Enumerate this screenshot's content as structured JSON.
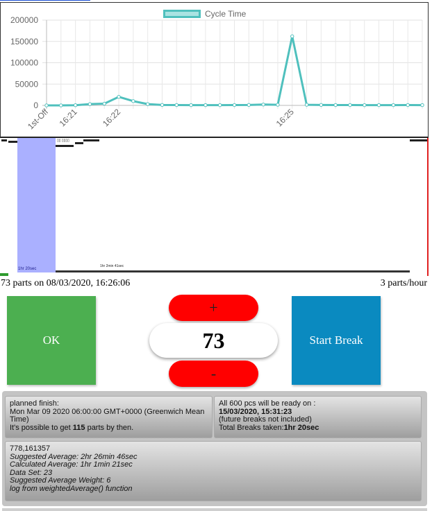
{
  "chart_data": {
    "type": "line",
    "legend": "Cycle Time",
    "x": [
      "1st-Off",
      "",
      "16:21",
      "",
      "",
      "16:22",
      "",
      "",
      "",
      "",
      "",
      "",
      "",
      "",
      "",
      "",
      "",
      "16:25",
      "",
      "",
      "",
      "",
      "",
      "",
      "",
      "",
      ""
    ],
    "values": [
      0,
      0,
      500,
      3000,
      4000,
      20000,
      10000,
      3000,
      1000,
      800,
      700,
      700,
      600,
      800,
      1000,
      2000,
      1500,
      162000,
      1500,
      1000,
      800,
      800,
      600,
      700,
      700,
      800,
      700
    ],
    "ylim": [
      0,
      200000
    ],
    "yticks": [
      "200000",
      "150000",
      "100000",
      "50000",
      "0"
    ],
    "color": "#4fc0bd",
    "grid": true,
    "legend_position": "top"
  },
  "timeline": {
    "break_label": "1hr 20sec",
    "tiny_label": "1hr 2min 41sec"
  },
  "status": {
    "parts_info": "73 parts on 08/03/2020, 16:26:06",
    "rate": "3 parts/hour"
  },
  "buttons": {
    "ok": "OK",
    "start_break": "Start Break",
    "plus": "+",
    "minus": "-"
  },
  "counter": {
    "value": "73"
  },
  "plan": {
    "label": "planned finish:",
    "date": "Mon Mar 09 2020 06:00:00 GMT+0000 (Greenwich Mean Time)",
    "possible_prefix": "It's possible to get ",
    "possible_count": "115",
    "possible_suffix": " parts by then."
  },
  "ready": {
    "label": "All 600 pcs will be ready on :",
    "date": "15/03/2020, 15:31:23",
    "note": "(future breaks not included)",
    "breaks_prefix": "Total Breaks taken:",
    "breaks_value": "1hr 20sec"
  },
  "stats": {
    "raw": "778,161357",
    "suggested_avg": "Suggested Average: 2hr 26min 46sec",
    "calculated_avg": "Calculated Average: 1hr 1min 21sec",
    "data_set": "Data Set: 23",
    "weight": "Suggested Average Weight: 6",
    "log": "log from weightedAverage() function"
  }
}
